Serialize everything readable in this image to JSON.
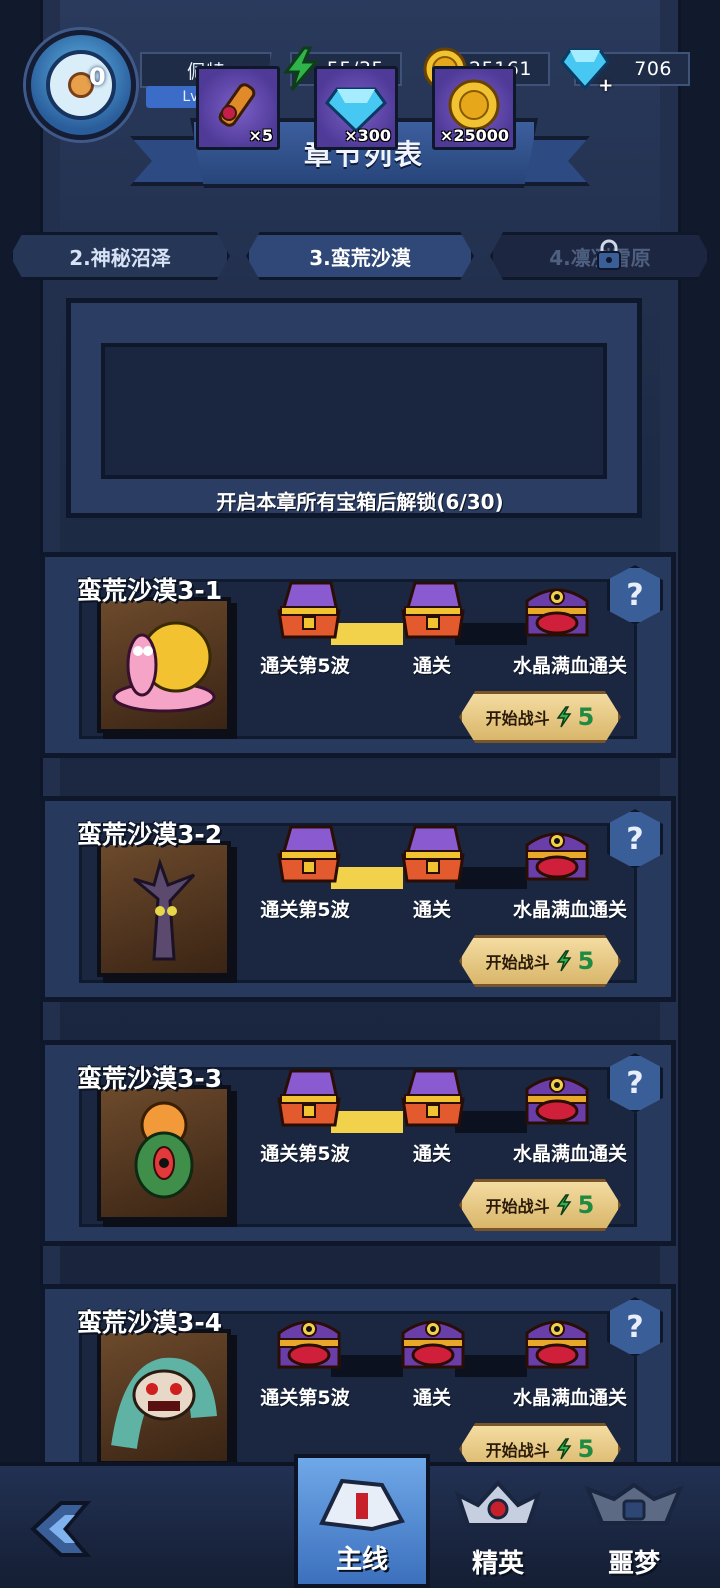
{
  "player": {
    "name": "佩特",
    "level": "Lv.10",
    "avatar_badge": "0"
  },
  "resources": {
    "energy": "55/35",
    "gold": "25161",
    "gems": "706"
  },
  "header": {
    "title": "章节列表"
  },
  "chapters": [
    {
      "label": "2.神秘沼泽",
      "state": "normal"
    },
    {
      "label": "3.蛮荒沙漠",
      "state": "active"
    },
    {
      "label": "4.凛冽雪原",
      "state": "locked"
    }
  ],
  "chapter_rewards": {
    "items": [
      {
        "icon": "scroll-icon",
        "count": "×5"
      },
      {
        "icon": "gem-icon",
        "count": "×300"
      },
      {
        "icon": "gold-coin-icon",
        "count": "×25000"
      }
    ],
    "unlock_text": "开启本章所有宝箱后解锁(6/30)"
  },
  "stages": [
    {
      "title": "蛮荒沙漠3-1",
      "monster": "snail-monster",
      "chests": [
        {
          "label": "通关第5波",
          "opened": true
        },
        {
          "label": "通关",
          "opened": true
        },
        {
          "label": "水晶满血通关",
          "opened": false
        }
      ],
      "fight_label": "开始战斗",
      "energy_cost": "5"
    },
    {
      "title": "蛮荒沙漠3-2",
      "monster": "tree-monster",
      "chests": [
        {
          "label": "通关第5波",
          "opened": true
        },
        {
          "label": "通关",
          "opened": true
        },
        {
          "label": "水晶满血通关",
          "opened": false
        }
      ],
      "fight_label": "开始战斗",
      "energy_cost": "5"
    },
    {
      "title": "蛮荒沙漠3-3",
      "monster": "plant-monster",
      "chests": [
        {
          "label": "通关第5波",
          "opened": true
        },
        {
          "label": "通关",
          "opened": true
        },
        {
          "label": "水晶满血通关",
          "opened": false
        }
      ],
      "fight_label": "开始战斗",
      "energy_cost": "5"
    },
    {
      "title": "蛮荒沙漠3-4",
      "monster": "worm-monster",
      "chests": [
        {
          "label": "通关第5波",
          "opened": false
        },
        {
          "label": "通关",
          "opened": false
        },
        {
          "label": "水晶满血通关",
          "opened": false
        }
      ],
      "fight_label": "开始战斗",
      "energy_cost": "5"
    }
  ],
  "bottom_nav": {
    "tabs": [
      {
        "label": "主线",
        "active": true
      },
      {
        "label": "精英",
        "active": false
      },
      {
        "label": "噩梦",
        "active": false
      }
    ]
  },
  "colors": {
    "background": "#1b2740",
    "panel": "#27395d",
    "accent_blue": "#3b6cc7",
    "gold": "#f1c232",
    "energy_green": "#2fb34a",
    "chest_bar_opened": "#f2d24b",
    "chest_bar_closed": "#0c1120"
  }
}
